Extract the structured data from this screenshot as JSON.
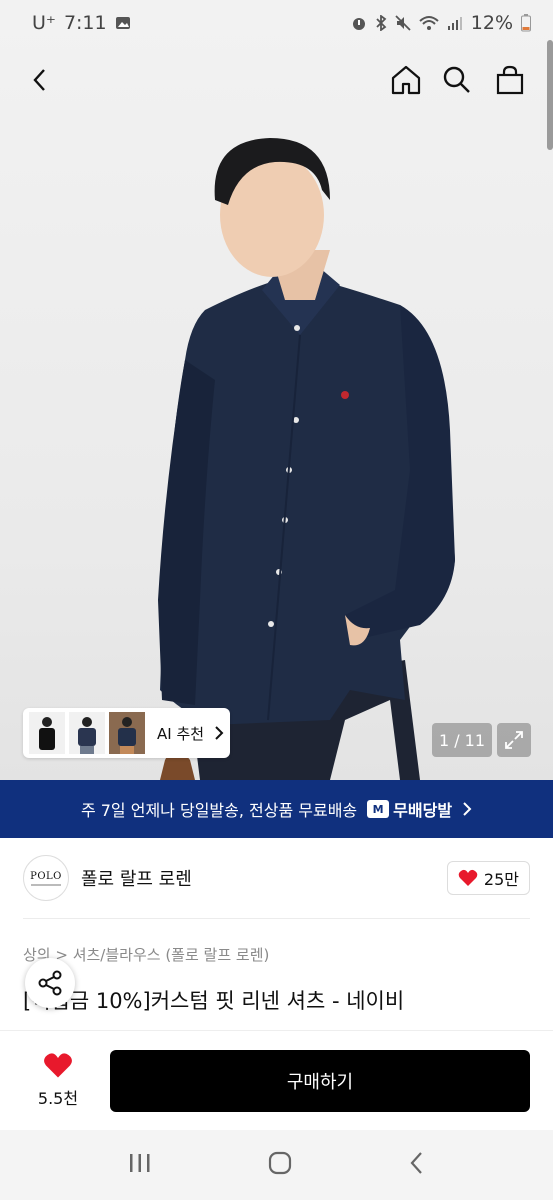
{
  "status_bar": {
    "carrier": "U⁺",
    "time": "7:11",
    "battery": "12%"
  },
  "hero": {
    "page_counter": "1 / 11",
    "ai_recommend_label": "AI 추천",
    "shirt_color": "#1f2c45"
  },
  "shipping_banner": {
    "text": "주 7일 언제나 당일발송, 전상품 무료배송",
    "badge_mark": "M",
    "badge_text": "무배당발",
    "background": "#10307e"
  },
  "brand": {
    "logo_text": "POLO",
    "name": "폴로 랄프 로렌",
    "like_count": "25만"
  },
  "product": {
    "category": "상의 > 셔츠/블라우스 (폴로 랄프 로렌)",
    "title": "[적립금 10%]커스텀 핏 리넨 셔츠 - 네이비"
  },
  "action_bar": {
    "wish_count": "5.5천",
    "buy_label": "구매하기"
  },
  "colors": {
    "heart": "#e8192c",
    "buy_button": "#000000"
  }
}
